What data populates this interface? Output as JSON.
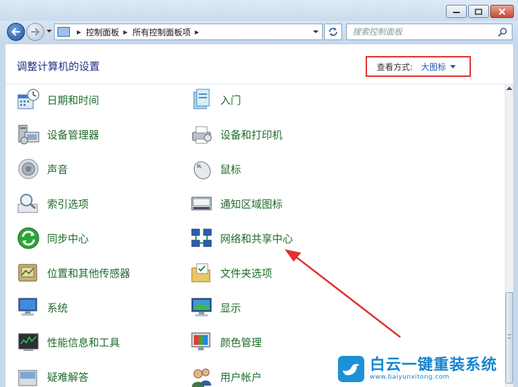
{
  "address": {
    "crumbs": [
      "控制面板",
      "所有控制面板项"
    ]
  },
  "search": {
    "placeholder": "搜索控制面板"
  },
  "header": {
    "title": "调整计算机的设置",
    "view_by_label": "查看方式:",
    "view_by_value": "大图标"
  },
  "items": {
    "left": [
      "日期和时间",
      "设备管理器",
      "声音",
      "索引选项",
      "同步中心",
      "位置和其他传感器",
      "系统",
      "性能信息和工具",
      "疑难解答"
    ],
    "right": [
      "入门",
      "设备和打印机",
      "鼠标",
      "通知区域图标",
      "网络和共享中心",
      "文件夹选项",
      "显示",
      "颜色管理",
      "用户帐户"
    ]
  },
  "icons": {
    "left": [
      "calendar-clock-icon",
      "device-manager-icon",
      "speaker-icon",
      "index-options-icon",
      "sync-center-icon",
      "location-sensors-icon",
      "system-icon",
      "performance-icon",
      "troubleshooting-icon"
    ],
    "right": [
      "getting-started-icon",
      "devices-printers-icon",
      "mouse-icon",
      "notification-icons-icon",
      "network-sharing-icon",
      "folder-options-icon",
      "display-icon",
      "color-management-icon",
      "user-accounts-icon"
    ]
  },
  "colors": {
    "item_link": "#1f6b2d",
    "title": "#1e3287",
    "highlight": "#e03030",
    "watermark": "#1584cf"
  },
  "watermark": {
    "name": "白云一键重装系统",
    "url": "www.baiyunxitong.com"
  }
}
